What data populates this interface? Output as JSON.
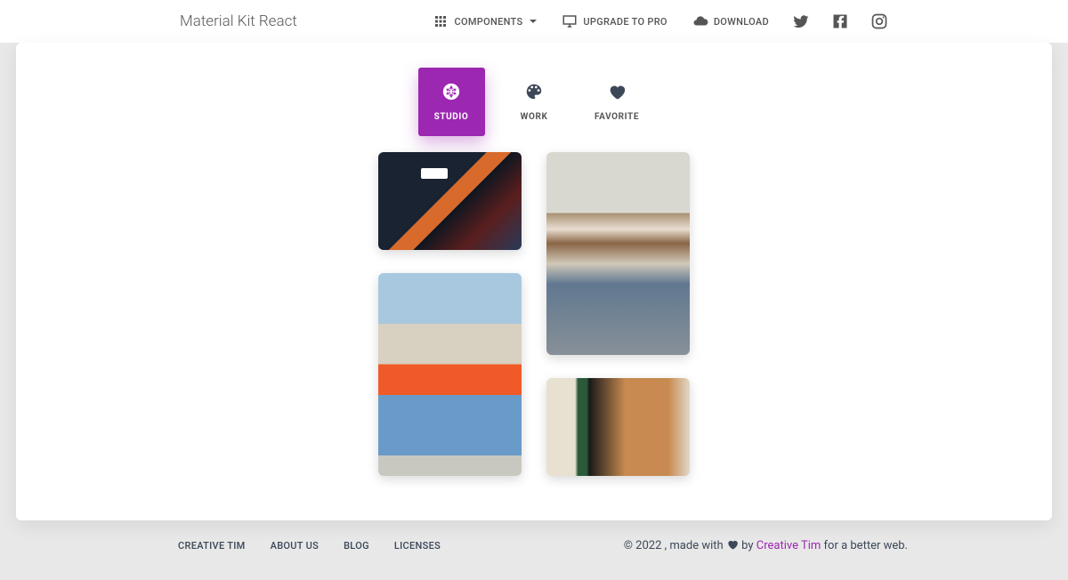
{
  "header": {
    "brand": "Material Kit React",
    "nav": {
      "components": "Components",
      "upgrade": "Upgrade to Pro",
      "download": "Download"
    }
  },
  "tabs": {
    "studio": "STUDIO",
    "work": "WORK",
    "favorite": "FAVORITE"
  },
  "footer": {
    "links": {
      "creative_tim": "Creative Tim",
      "about": "About Us",
      "blog": "Blog",
      "licenses": "Licenses"
    },
    "copyright_prefix": "© 2022 , made with ",
    "copyright_by": " by ",
    "copyright_link": "Creative Tim",
    "copyright_suffix": " for a better web."
  }
}
